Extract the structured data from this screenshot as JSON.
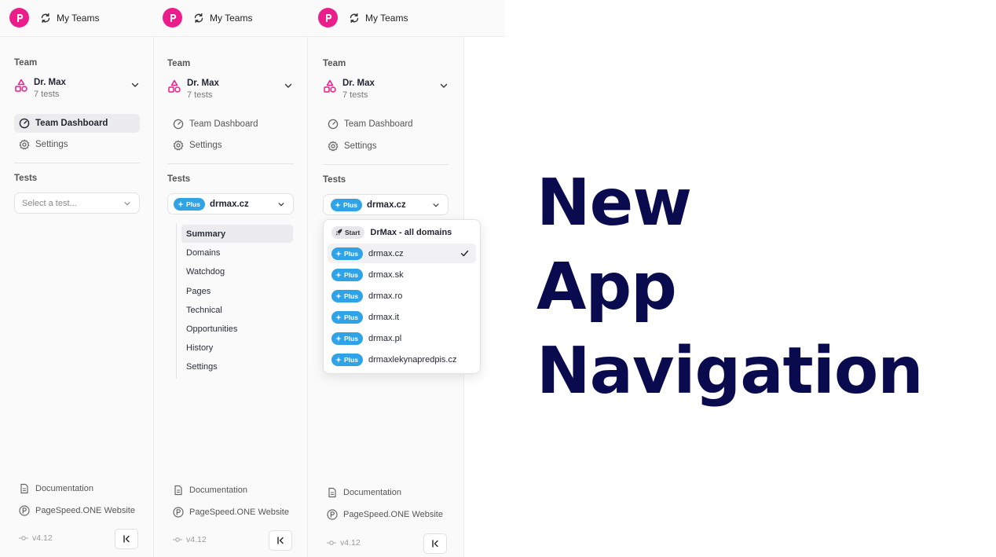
{
  "topbar": {
    "teams_label": "My Teams"
  },
  "sidebar": {
    "team_section": "Team",
    "team_name": "Dr. Max",
    "team_sub": "7 tests",
    "nav": {
      "dashboard": "Team Dashboard",
      "settings": "Settings"
    },
    "tests_section": "Tests",
    "select_placeholder": "Select a test...",
    "selected_test": "drmax.cz",
    "plus_label": "Plus",
    "start_label": "Start"
  },
  "submenu": [
    "Summary",
    "Domains",
    "Watchdog",
    "Pages",
    "Technical",
    "Opportunities",
    "History",
    "Settings"
  ],
  "dropdown": [
    {
      "badge": "Start",
      "name": "DrMax - all domains"
    },
    {
      "badge": "Plus",
      "name": "drmax.cz"
    },
    {
      "badge": "Plus",
      "name": "drmax.sk"
    },
    {
      "badge": "Plus",
      "name": "drmax.ro"
    },
    {
      "badge": "Plus",
      "name": "drmax.it"
    },
    {
      "badge": "Plus",
      "name": "drmax.pl"
    },
    {
      "badge": "Plus",
      "name": "drmaxlekynapredpis.cz"
    }
  ],
  "footer": {
    "documentation": "Documentation",
    "website": "PageSpeed.ONE Website",
    "version": "v4.12"
  },
  "headline": {
    "line1": "New",
    "line2": "App",
    "line3": "Navigation"
  },
  "colors": {
    "brand": "#ec1c8b",
    "plus_badge": "#2fa3e6",
    "headline": "#0a0a4f"
  }
}
